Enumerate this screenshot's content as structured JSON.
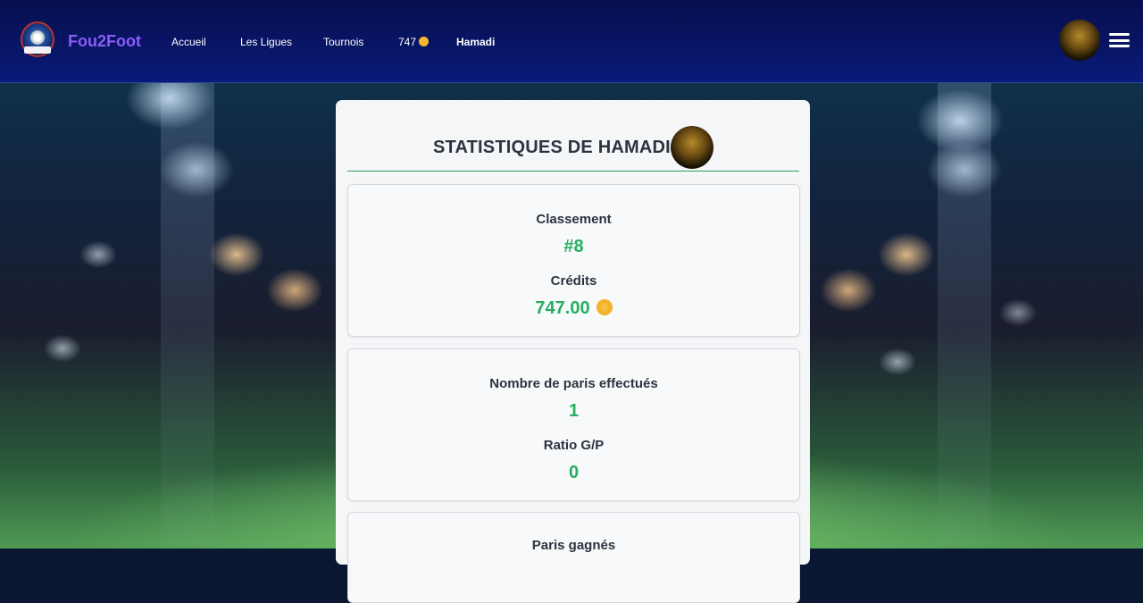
{
  "header": {
    "brand": "Fou2Foot",
    "nav": {
      "home": "Accueil",
      "leagues": "Les Ligues",
      "tournaments": "Tournois",
      "credits": "747",
      "user": "Hamadi"
    }
  },
  "stats": {
    "title": "STATISTIQUES DE HAMADI",
    "ranking_label": "Classement",
    "ranking_value": "#8",
    "credits_label": "Crédits",
    "credits_value": "747.00",
    "bets_label": "Nombre de paris effectués",
    "bets_value": "1",
    "ratio_label": "Ratio G/P",
    "ratio_value": "0",
    "won_label": "Paris gagnés"
  },
  "colors": {
    "navbar": "#0a1a78",
    "brand": "#8b5cf6",
    "accent_green": "#27ae60",
    "coin": "#f5b82e"
  }
}
